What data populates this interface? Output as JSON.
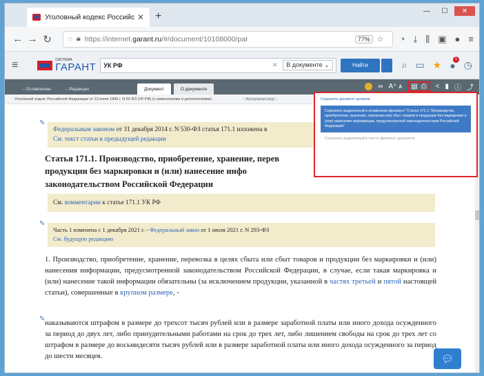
{
  "browser": {
    "tab_title": "Уголовный кодекс Российс",
    "tab_close": "✕",
    "new_tab": "+",
    "url_prefix": "https://internet.",
    "url_domain": "garant.ru",
    "url_suffix": "/#/document/10108000/par",
    "zoom": "77%"
  },
  "garant": {
    "logo_small": "СИСТЕМА",
    "logo_name": "ГАРАНТ",
    "search_query": "УК РФ",
    "search_scope": "В документе ⌄",
    "find_label": "Найти"
  },
  "doc_tabs": {
    "contents": "Оглавление",
    "editions": "Редакции",
    "document": "Документ",
    "about": "О документе"
  },
  "breadcrumb": {
    "left": "Уголовный кодекс Российской Федерации от 13 июня 1996 г. N 63-ФЗ (УК РФ) (с изменениями и дополнениями)",
    "right": "Актуальная ред"
  },
  "notes": {
    "n1_link": "Федеральным законом",
    "n1_text": " от 31 декабря 2014 г. N 530-ФЗ статья 171.1 изложена в",
    "n1_link2": "См. текст статьи в предыдущей редакции",
    "n2_prefix": "См. ",
    "n2_link": "комментарии",
    "n2_suffix": " к статье 171.1 УК РФ",
    "n3_prefix": "Часть 1 изменена с 1 декабря 2021 г. - ",
    "n3_link": "Федеральный закон",
    "n3_suffix": " от 1 июля 2021 г. N 293-ФЗ",
    "n3_link2": "См. будущую редакцию"
  },
  "article": {
    "heading_line1": "Статья 171.1. Производство, приобретение, хранение, перев",
    "heading_line2": "продукции без маркировки и (или) нанесение инфо",
    "heading_line3": "законодательством Российской Федерации",
    "p1_text": "1. Производство, приобретение, хранение, перевозка в целях сбыта или сбыт товаров и продукции без маркировки и (или) нанесения информации, предусмотренной законодательством Российской Федерации, в случае, если такая маркировка и (или) нанесение такой информации обязательны (за исключением продукции, указанной в ",
    "p1_link1": "частях третьей",
    "p1_and": " и ",
    "p1_link2": "пятой",
    "p1_mid": " настоящей статьи), совершенные в ",
    "p1_link3": "крупном размере",
    "p1_end": ", -",
    "p2_text": "наказываются штрафом в размере до трехсот тысяч рублей или в размере заработной платы или иного дохода осужденного за период до двух лет, либо принудительными работами на срок до трех лет, либо лишением свободы на срок до трех лет со штрафом в размере до восьмидесяти тысяч рублей или в размере заработной платы или иного дохода осужденного за период до шести месяцев."
  },
  "popup": {
    "save_whole": "Сохранить документ целиком",
    "save_fragment": "Сохранить выделенный в оглавлении фрагмент \"Статья 171.1. Производство, приобретение, хранение, перевозка или сбыт товаров и продукции без маркировки и (или) нанесения информации, предусмотренной законодательством Российской Федерации\"",
    "save_selected": "Сохранить выделенный в тексте фрагмент документа"
  }
}
